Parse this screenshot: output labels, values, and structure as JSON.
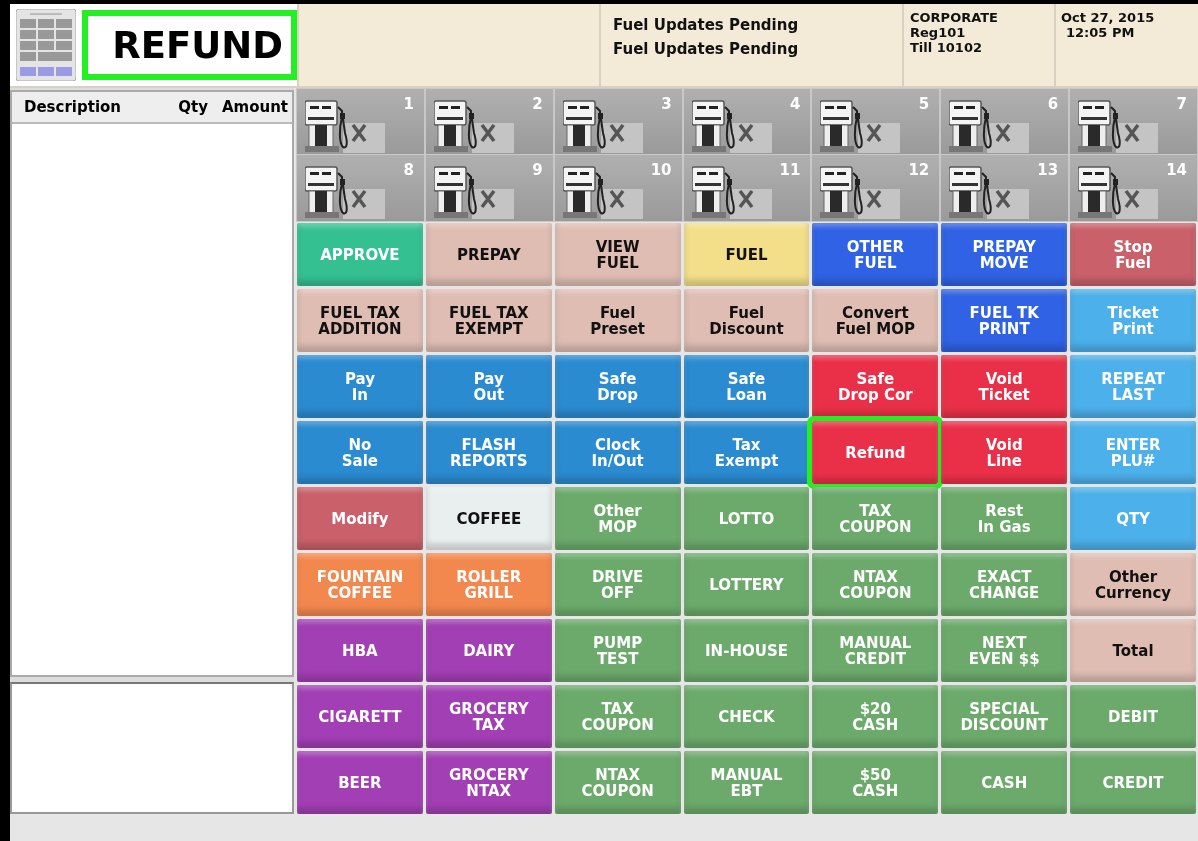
{
  "header": {
    "title": "REFUND",
    "title_highlighted": true,
    "messages": [
      "Fuel Updates Pending",
      "Fuel Updates Pending"
    ],
    "store": [
      "CORPORATE",
      "Reg101",
      "Till 10102"
    ],
    "datetime": [
      "Oct 27, 2015",
      "12:05 PM"
    ]
  },
  "ticket": {
    "columns": [
      "Description",
      "Qty",
      "Amount"
    ]
  },
  "pumps": [
    {
      "number": "1"
    },
    {
      "number": "2"
    },
    {
      "number": "3"
    },
    {
      "number": "4"
    },
    {
      "number": "5"
    },
    {
      "number": "6"
    },
    {
      "number": "7"
    },
    {
      "number": "8"
    },
    {
      "number": "9"
    },
    {
      "number": "10"
    },
    {
      "number": "11"
    },
    {
      "number": "12"
    },
    {
      "number": "13"
    },
    {
      "number": "14"
    }
  ],
  "keys": [
    {
      "label": "APPROVE",
      "color": "#35c092",
      "highlighted": false
    },
    {
      "label": "PREPAY",
      "color": "#dfbdb3",
      "highlighted": false
    },
    {
      "label": "VIEW\nFUEL",
      "color": "#dfbdb3",
      "highlighted": false
    },
    {
      "label": "FUEL",
      "color": "#f3df8a",
      "highlighted": false
    },
    {
      "label": "OTHER\nFUEL",
      "color": "#2f62e4",
      "highlighted": false
    },
    {
      "label": "PREPAY\nMOVE",
      "color": "#2f62e4",
      "highlighted": false
    },
    {
      "label": "Stop\nFuel",
      "color": "#c9606a",
      "highlighted": false
    },
    {
      "label": "FUEL TAX\nADDITION",
      "color": "#dfbdb3",
      "highlighted": false
    },
    {
      "label": "FUEL TAX\nEXEMPT",
      "color": "#dfbdb3",
      "highlighted": false
    },
    {
      "label": "Fuel\nPreset",
      "color": "#dfbdb3",
      "highlighted": false
    },
    {
      "label": "Fuel\nDiscount",
      "color": "#dfbdb3",
      "highlighted": false
    },
    {
      "label": "Convert\nFuel MOP",
      "color": "#dfbdb3",
      "highlighted": false
    },
    {
      "label": "FUEL TK\nPRINT",
      "color": "#2f62e4",
      "highlighted": false
    },
    {
      "label": "Ticket\nPrint",
      "color": "#4cb0ea",
      "highlighted": false
    },
    {
      "label": "Pay\nIn",
      "color": "#2b8bd0",
      "highlighted": false
    },
    {
      "label": "Pay\nOut",
      "color": "#2b8bd0",
      "highlighted": false
    },
    {
      "label": "Safe\nDrop",
      "color": "#2b8bd0",
      "highlighted": false
    },
    {
      "label": "Safe\nLoan",
      "color": "#2b8bd0",
      "highlighted": false
    },
    {
      "label": "Safe\nDrop Cor",
      "color": "#ea3048",
      "highlighted": false
    },
    {
      "label": "Void\nTicket",
      "color": "#ea3048",
      "highlighted": false
    },
    {
      "label": "REPEAT\nLAST",
      "color": "#4cb0ea",
      "highlighted": false
    },
    {
      "label": "No\nSale",
      "color": "#2b8bd0",
      "highlighted": false
    },
    {
      "label": "FLASH\nREPORTS",
      "color": "#2b8bd0",
      "highlighted": false
    },
    {
      "label": "Clock\nIn/Out",
      "color": "#2b8bd0",
      "highlighted": false
    },
    {
      "label": "Tax\nExempt",
      "color": "#2b8bd0",
      "highlighted": false
    },
    {
      "label": "Refund",
      "color": "#ea3048",
      "highlighted": true
    },
    {
      "label": "Void\nLine",
      "color": "#ea3048",
      "highlighted": false
    },
    {
      "label": "ENTER\nPLU#",
      "color": "#4cb0ea",
      "highlighted": false
    },
    {
      "label": "Modify",
      "color": "#c9606a",
      "highlighted": false
    },
    {
      "label": "COFFEE",
      "color": "#e9eeee",
      "highlighted": false
    },
    {
      "label": "Other\nMOP",
      "color": "#6caa6c",
      "highlighted": false
    },
    {
      "label": "LOTTO",
      "color": "#6caa6c",
      "highlighted": false
    },
    {
      "label": "TAX\nCOUPON",
      "color": "#6caa6c",
      "highlighted": false
    },
    {
      "label": "Rest\nIn Gas",
      "color": "#6caa6c",
      "highlighted": false
    },
    {
      "label": "QTY",
      "color": "#4cb0ea",
      "highlighted": false
    },
    {
      "label": "FOUNTAIN\nCOFFEE",
      "color": "#f3884e",
      "highlighted": false
    },
    {
      "label": "ROLLER\nGRILL",
      "color": "#f3884e",
      "highlighted": false
    },
    {
      "label": "DRIVE\nOFF",
      "color": "#6caa6c",
      "highlighted": false
    },
    {
      "label": "LOTTERY",
      "color": "#6caa6c",
      "highlighted": false
    },
    {
      "label": "NTAX\nCOUPON",
      "color": "#6caa6c",
      "highlighted": false
    },
    {
      "label": "EXACT\nCHANGE",
      "color": "#6caa6c",
      "highlighted": false
    },
    {
      "label": "Other\nCurrency",
      "color": "#dfbdb3",
      "highlighted": false
    },
    {
      "label": "HBA",
      "color": "#a23fb4",
      "highlighted": false
    },
    {
      "label": "DAIRY",
      "color": "#a23fb4",
      "highlighted": false
    },
    {
      "label": "PUMP\nTEST",
      "color": "#6caa6c",
      "highlighted": false
    },
    {
      "label": "IN-HOUSE",
      "color": "#6caa6c",
      "highlighted": false
    },
    {
      "label": "MANUAL\nCREDIT",
      "color": "#6caa6c",
      "highlighted": false
    },
    {
      "label": "NEXT\nEVEN $$",
      "color": "#6caa6c",
      "highlighted": false
    },
    {
      "label": "Total",
      "color": "#dfbdb3",
      "highlighted": false
    },
    {
      "label": "CIGARETT",
      "color": "#a23fb4",
      "highlighted": false
    },
    {
      "label": "GROCERY\nTAX",
      "color": "#a23fb4",
      "highlighted": false
    },
    {
      "label": "TAX\nCOUPON",
      "color": "#6caa6c",
      "highlighted": false
    },
    {
      "label": "CHECK",
      "color": "#6caa6c",
      "highlighted": false
    },
    {
      "label": "$20\nCASH",
      "color": "#6caa6c",
      "highlighted": false
    },
    {
      "label": "SPECIAL\nDISCOUNT",
      "color": "#6caa6c",
      "highlighted": false
    },
    {
      "label": "DEBIT",
      "color": "#6caa6c",
      "highlighted": false
    },
    {
      "label": "BEER",
      "color": "#a23fb4",
      "highlighted": false
    },
    {
      "label": "GROCERY\nNTAX",
      "color": "#a23fb4",
      "highlighted": false
    },
    {
      "label": "NTAX\nCOUPON",
      "color": "#6caa6c",
      "highlighted": false
    },
    {
      "label": "MANUAL\nEBT",
      "color": "#6caa6c",
      "highlighted": false
    },
    {
      "label": "$50\nCASH",
      "color": "#6caa6c",
      "highlighted": false
    },
    {
      "label": "CASH",
      "color": "#6caa6c",
      "highlighted": false
    },
    {
      "label": "CREDIT",
      "color": "#6caa6c",
      "highlighted": false
    }
  ]
}
